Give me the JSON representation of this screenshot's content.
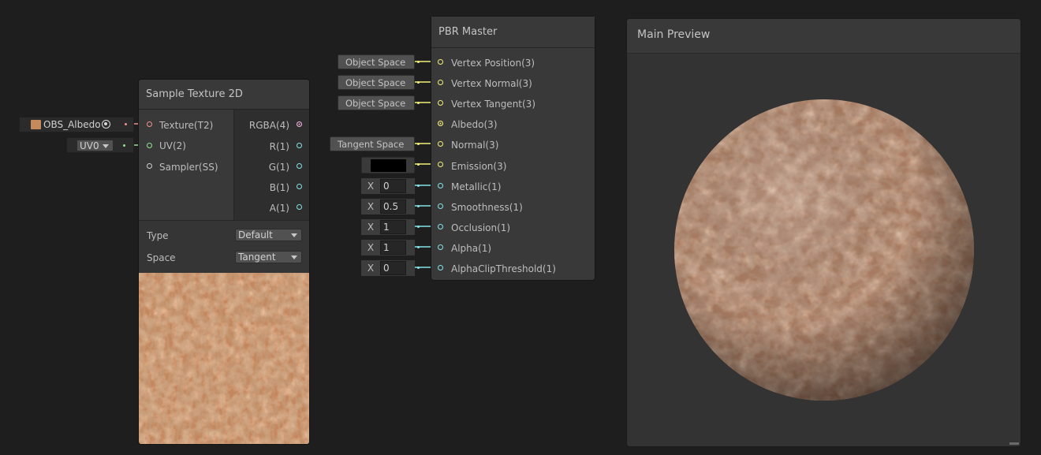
{
  "sample_node": {
    "title": "Sample Texture 2D",
    "inputs": [
      {
        "label": "Texture(T2)",
        "color": "#f09090"
      },
      {
        "label": "UV(2)",
        "color": "#8ee38e"
      },
      {
        "label": "Sampler(SS)",
        "color": "#cfcfcf"
      }
    ],
    "outputs": [
      {
        "label": "RGBA(4)",
        "color": "#f0b0e0"
      },
      {
        "label": "R(1)",
        "color": "#84e4e7"
      },
      {
        "label": "G(1)",
        "color": "#84e4e7"
      },
      {
        "label": "B(1)",
        "color": "#84e4e7"
      },
      {
        "label": "A(1)",
        "color": "#84e4e7"
      }
    ],
    "type_label": "Type",
    "type_value": "Default",
    "space_label": "Space",
    "space_value": "Tangent"
  },
  "texture_input": {
    "name": "OBS_Albedo",
    "swatch_color": "#c58a5c"
  },
  "uv_input": {
    "value": "UV0"
  },
  "master_node": {
    "title": "PBR Master",
    "ports": [
      {
        "label": "Vertex Position(3)",
        "color": "#f4f07a"
      },
      {
        "label": "Vertex Normal(3)",
        "color": "#f4f07a"
      },
      {
        "label": "Vertex Tangent(3)",
        "color": "#f4f07a"
      },
      {
        "label": "Albedo(3)",
        "color": "#f4f07a"
      },
      {
        "label": "Normal(3)",
        "color": "#f4f07a"
      },
      {
        "label": "Emission(3)",
        "color": "#f4f07a"
      },
      {
        "label": "Metallic(1)",
        "color": "#84e4e7"
      },
      {
        "label": "Smoothness(1)",
        "color": "#84e4e7"
      },
      {
        "label": "Occlusion(1)",
        "color": "#84e4e7"
      },
      {
        "label": "Alpha(1)",
        "color": "#84e4e7"
      },
      {
        "label": "AlphaClipThreshold(1)",
        "color": "#84e4e7"
      }
    ]
  },
  "master_inputs": {
    "vertex_position": "Object Space",
    "vertex_normal": "Object Space",
    "vertex_tangent": "Object Space",
    "normal": "Tangent Space",
    "emission_color": "#000000",
    "x_label": "X",
    "metallic": "0",
    "smoothness": "0.5",
    "occlusion": "1",
    "alpha": "1",
    "alpha_clip": "0"
  },
  "preview": {
    "title": "Main Preview"
  },
  "colors": {
    "background": "#1e1e1e",
    "node": "#393939",
    "vector3_port": "#f4f07a",
    "vector1_port": "#84e4e7",
    "texture_port": "#f09090",
    "uv_port": "#8ee38e",
    "rgba_wire": "#e9bde3"
  }
}
